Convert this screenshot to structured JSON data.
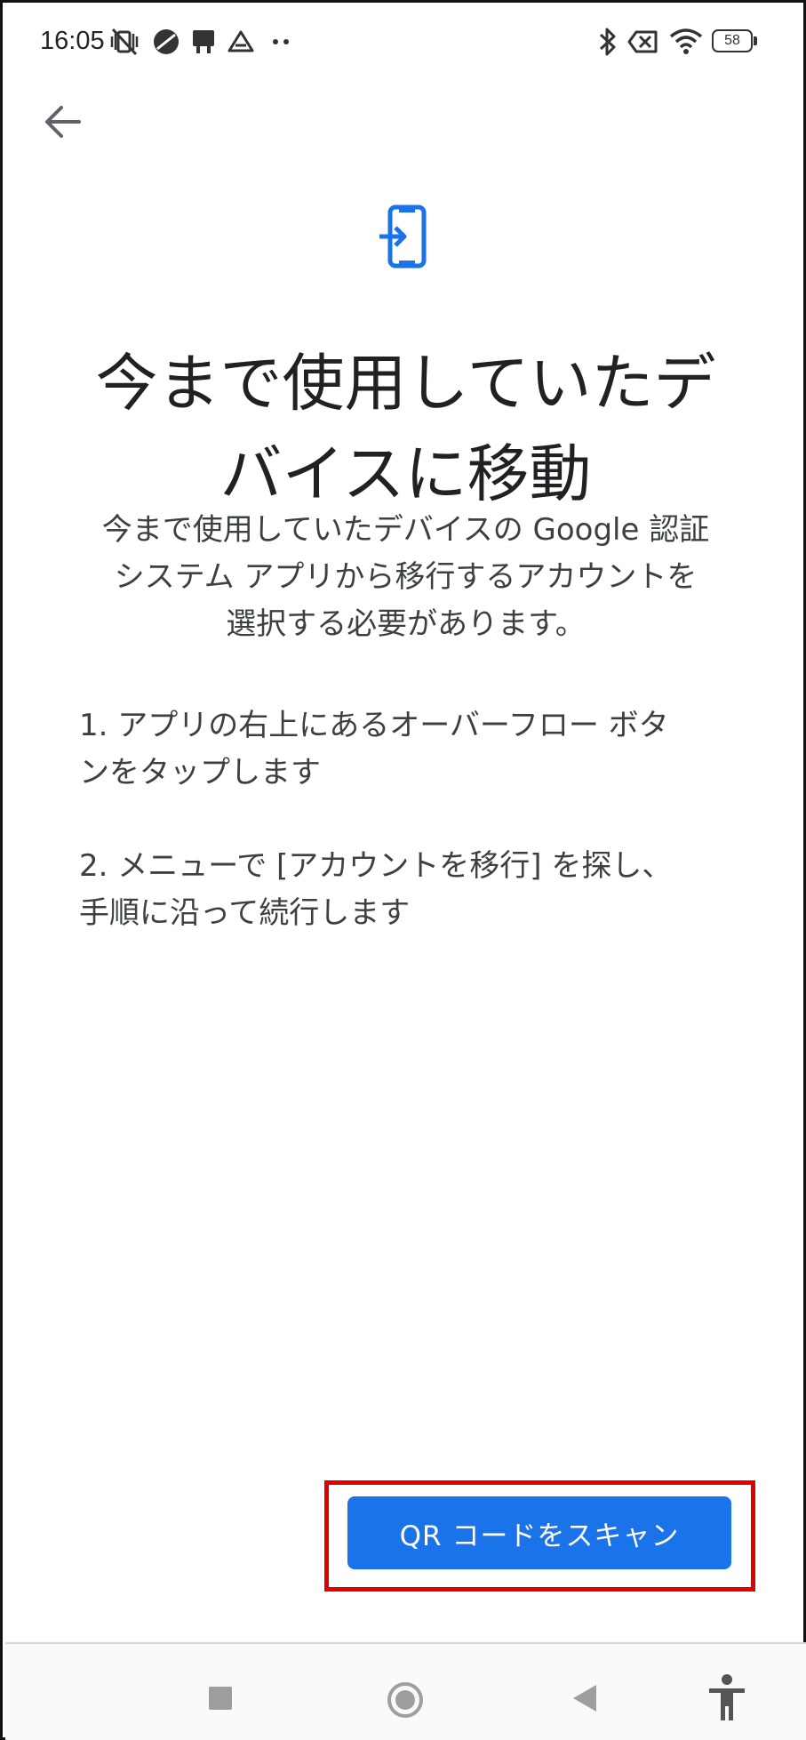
{
  "status_bar": {
    "time": "16:05",
    "left_icons": [
      "mute-vibrate-icon",
      "vpn-icon",
      "cast-icon",
      "drive-icon",
      "more-dots-icon"
    ],
    "right_icons": [
      "bluetooth-icon",
      "no-sim-icon",
      "wifi-icon",
      "battery-icon"
    ],
    "battery_level": "58"
  },
  "header": {
    "back_icon": "arrow-left-icon"
  },
  "hero": {
    "icon": "device-transfer-icon",
    "accent_color": "#1a73e8",
    "title_line1": "今まで使用していたデ",
    "title_line2": "バイスに移動"
  },
  "description": {
    "line1": "今まで使用していたデバイスの Google 認証",
    "line2": "システム アプリから移行するアカウントを",
    "line3": "選択する必要があります。"
  },
  "steps": [
    {
      "line1": "1. アプリの右上にあるオーバーフロー ボタ",
      "line2": "ンをタップします"
    },
    {
      "line1": "2. メニューで [アカウントを移行] を探し、",
      "line2": "手順に沿って続行します"
    }
  ],
  "actions": {
    "scan_label": "QR コードをスキャン",
    "highlight_color": "#e00000"
  },
  "nav_bar": {
    "items": [
      "recents-square-icon",
      "home-circle-icon",
      "back-triangle-icon",
      "accessibility-icon"
    ]
  }
}
